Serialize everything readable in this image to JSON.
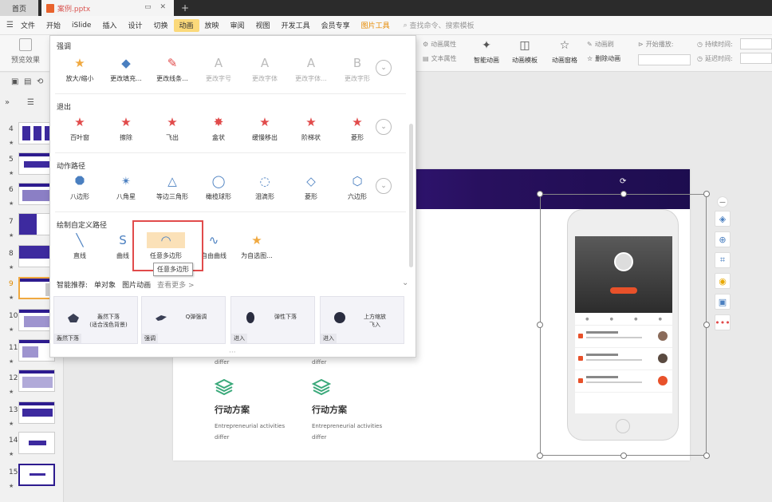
{
  "tabs": {
    "home": "首页",
    "file": "案例.pptx"
  },
  "menu": {
    "items": [
      "文件",
      "开始",
      "iSlide",
      "插入",
      "设计",
      "切换",
      "动画",
      "放映",
      "审阅",
      "视图",
      "开发工具",
      "会员专享",
      "图片工具"
    ],
    "active": "动画",
    "search": "查找命令、搜索模板"
  },
  "toolbar": {
    "preview": "预览效果",
    "anim_props": "动画属性",
    "text_props": "文本属性",
    "smart_anim": "智能动画",
    "anim_template": "动画模板",
    "anim_pane": "动画窗格",
    "anim_brush": "动画刷",
    "delete_anim": "删除动画",
    "start_play": "开始播放:",
    "duration": "持续时间:",
    "delay": "延迟时间:"
  },
  "panel": {
    "sections": {
      "emphasis": "强调",
      "exit": "退出",
      "motion": "动作路径",
      "custom": "绘制自定义路径"
    },
    "emphasis_items": [
      "放大/缩小",
      "更改填充...",
      "更改线条...",
      "更改字号",
      "更改字体",
      "更改字体...",
      "更改字形"
    ],
    "exit_items": [
      "百叶窗",
      "擦除",
      "飞出",
      "盒状",
      "缓慢移出",
      "阶梯状",
      "菱形"
    ],
    "motion_items": [
      "八边形",
      "八角星",
      "等边三角形",
      "橄榄球形",
      "泪滴形",
      "菱形",
      "六边形"
    ],
    "custom_items": [
      "直线",
      "曲线",
      "任意多边形",
      "自由曲线",
      "为自选图..."
    ],
    "tooltip": "任意多边形",
    "smart": {
      "label": "智能推荐:",
      "obj": "单对象",
      "pic": "图片动画",
      "more": "查看更多 >"
    },
    "cards": [
      {
        "title": "轰然下落\n(适合浅色背景)",
        "tag": "轰然下落"
      },
      {
        "title": "Q弹强调",
        "tag": "强调"
      },
      {
        "title": "弹性下落",
        "tag": "进入"
      },
      {
        "title": "上方缩放\n飞入",
        "tag": "进入"
      }
    ]
  },
  "slides": [
    "4",
    "5",
    "6",
    "7",
    "8",
    "9",
    "10",
    "11",
    "12",
    "13",
    "14",
    "15"
  ],
  "slide": {
    "feature_title": "行动方案",
    "feature_sub": "Entrepreneurial activities",
    "feature_sub2": "differ",
    "differ": "differ"
  },
  "colors": {
    "accent": "#fbd97a",
    "slide_header": "#2d1b8f",
    "feature_icon": "#3aa97a",
    "highlight": "#e14b4b"
  }
}
